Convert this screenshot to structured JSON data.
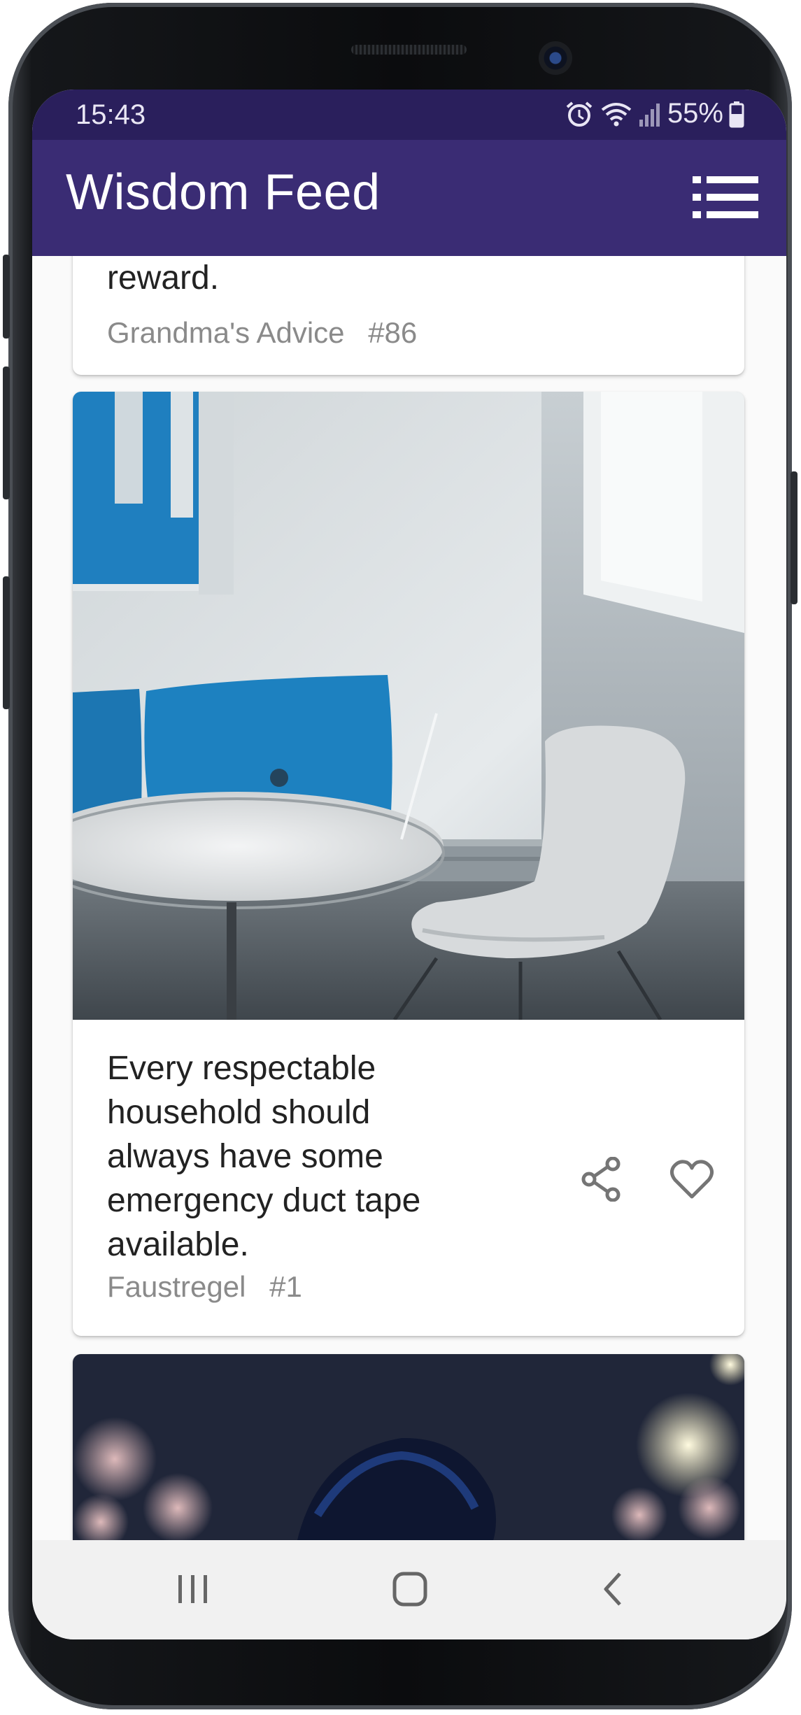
{
  "status_bar": {
    "time": "15:43",
    "battery": "55%",
    "icons": [
      "alarm-icon",
      "wifi-icon",
      "signal-icon",
      "battery-icon"
    ]
  },
  "app_bar": {
    "title": "Wisdom Feed",
    "menu_icon": "list-menu-icon"
  },
  "feed": {
    "items": [
      {
        "text": "reward.",
        "source": "Grandma's Advice",
        "number": "#86"
      },
      {
        "image": "room with white round table, white chair and blue cushions",
        "text_lines": [
          "Every respectable",
          "household should",
          "always have some",
          "emergency duct tape",
          "available."
        ],
        "source": "Faustregel",
        "number": "#1",
        "actions": [
          "share-icon",
          "heart-icon"
        ]
      },
      {
        "image": "person in front of blurred night lights"
      }
    ]
  },
  "nav_bar": {
    "buttons": [
      "recent-apps-icon",
      "home-icon",
      "back-icon"
    ]
  },
  "colors": {
    "status_bar": "#2a1f5c",
    "app_bar": "#3a2c74",
    "background": "#fafafa",
    "meta_text": "#8a8a8a"
  }
}
